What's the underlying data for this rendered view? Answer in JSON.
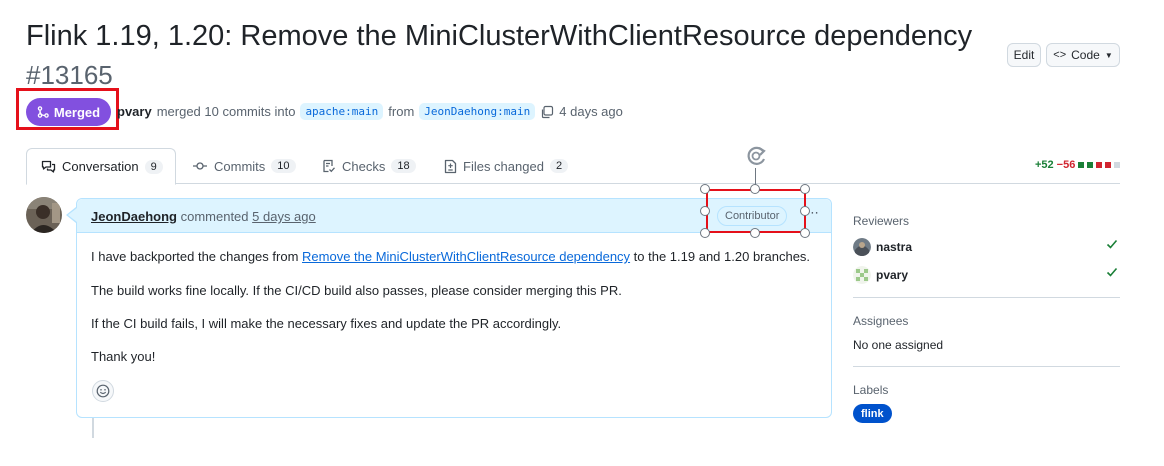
{
  "header": {
    "title": "Flink 1.19, 1.20: Remove the MiniClusterWithClientResource dependency",
    "number": "#13165",
    "edit_label": "Edit",
    "code_label": "Code"
  },
  "status": {
    "badge": "Merged",
    "author": "pvary",
    "action": "merged 10 commits into",
    "base_branch": "apache:main",
    "from_word": "from",
    "head_branch": "JeonDaehong:main",
    "time": "4 days ago"
  },
  "tabs": [
    {
      "label": "Conversation",
      "count": "9"
    },
    {
      "label": "Commits",
      "count": "10"
    },
    {
      "label": "Checks",
      "count": "18"
    },
    {
      "label": "Files changed",
      "count": "2"
    }
  ],
  "diffstat": {
    "additions": "+52",
    "deletions": "−56"
  },
  "comment": {
    "author": "JeonDaehong",
    "action": "commented",
    "time": "5 days ago",
    "role_badge": "Contributor",
    "line1_pre": "I have backported the changes from ",
    "line1_link": "Remove the MiniClusterWithClientResource dependency",
    "line1_post": " to the 1.19 and 1.20 branches.",
    "line2": "The build works fine locally. If the CI/CD build also passes, please consider merging this PR.",
    "line3": "If the CI build fails, I will make the necessary fixes and update the PR accordingly.",
    "line4": "Thank you!"
  },
  "sidebar": {
    "reviewers_heading": "Reviewers",
    "reviewers": [
      {
        "name": "nastra",
        "icon": "check-icon"
      },
      {
        "name": "pvary",
        "icon": "check-icon"
      }
    ],
    "assignees_heading": "Assignees",
    "assignees_value": "No one assigned",
    "labels_heading": "Labels",
    "labels": [
      "flink"
    ]
  },
  "colors": {
    "merged": "#8250df",
    "accent": "#0969da",
    "highlight": "#e5101a",
    "label_flink": "#0052cc"
  }
}
